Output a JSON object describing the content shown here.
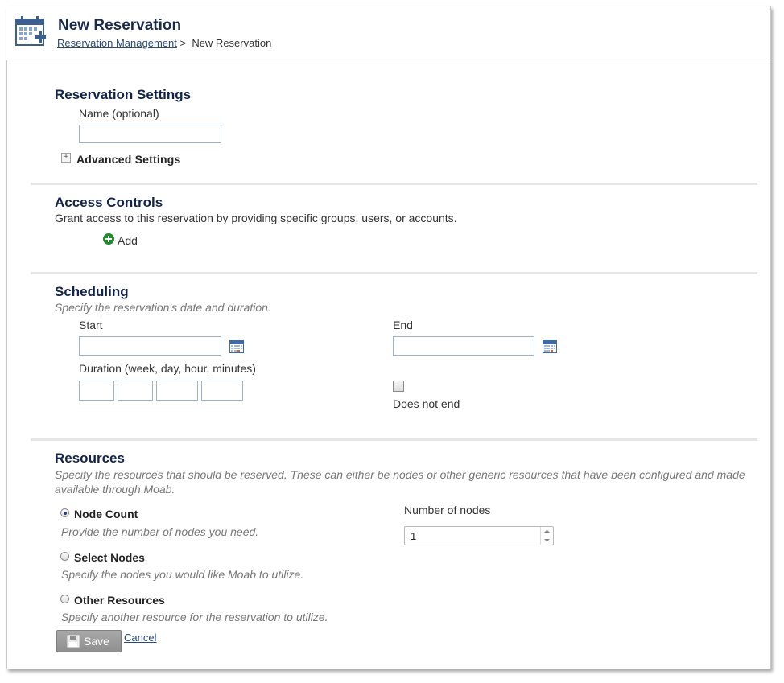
{
  "header": {
    "title": "New Reservation",
    "breadcrumb_link": "Reservation Management",
    "breadcrumb_sep": ">",
    "breadcrumb_current": "New Reservation"
  },
  "reservation_settings": {
    "title": "Reservation Settings",
    "name_label": "Name (optional)",
    "name_value": "",
    "advanced_label": "Advanced Settings"
  },
  "access_controls": {
    "title": "Access Controls",
    "description": "Grant access to this reservation by providing specific groups, users, or accounts.",
    "add_label": "Add"
  },
  "scheduling": {
    "title": "Scheduling",
    "description": "Specify the reservation's date and duration.",
    "start_label": "Start",
    "end_label": "End",
    "duration_label": "Duration (week, day, hour, minutes)",
    "does_not_end_label": "Does not end",
    "does_not_end_checked": false
  },
  "resources": {
    "title": "Resources",
    "description": "Specify the resources that should be reserved. These can either be nodes or other generic resources that have been configured and made available through Moab.",
    "options": [
      {
        "label": "Node Count",
        "hint": "Provide the number of nodes you need.",
        "checked": true
      },
      {
        "label": "Select Nodes",
        "hint": "Specify the nodes you would like Moab to utilize.",
        "checked": false
      },
      {
        "label": "Other Resources",
        "hint": "Specify another resource for the reservation to utilize.",
        "checked": false
      }
    ],
    "number_of_nodes_label": "Number of nodes",
    "number_of_nodes_value": "1"
  },
  "actions": {
    "save_label": "Save",
    "cancel_label": "Cancel"
  },
  "icons": {
    "header": "calendar-add-icon",
    "calendar": "calendar-icon",
    "add": "plus-circle-icon",
    "save": "floppy-disk-icon",
    "expander": "plus-box-icon"
  },
  "colors": {
    "title": "#13244a",
    "link": "#2a4a7b",
    "add_icon": "#1f8a2e",
    "save_button": "#9c9c9c"
  }
}
